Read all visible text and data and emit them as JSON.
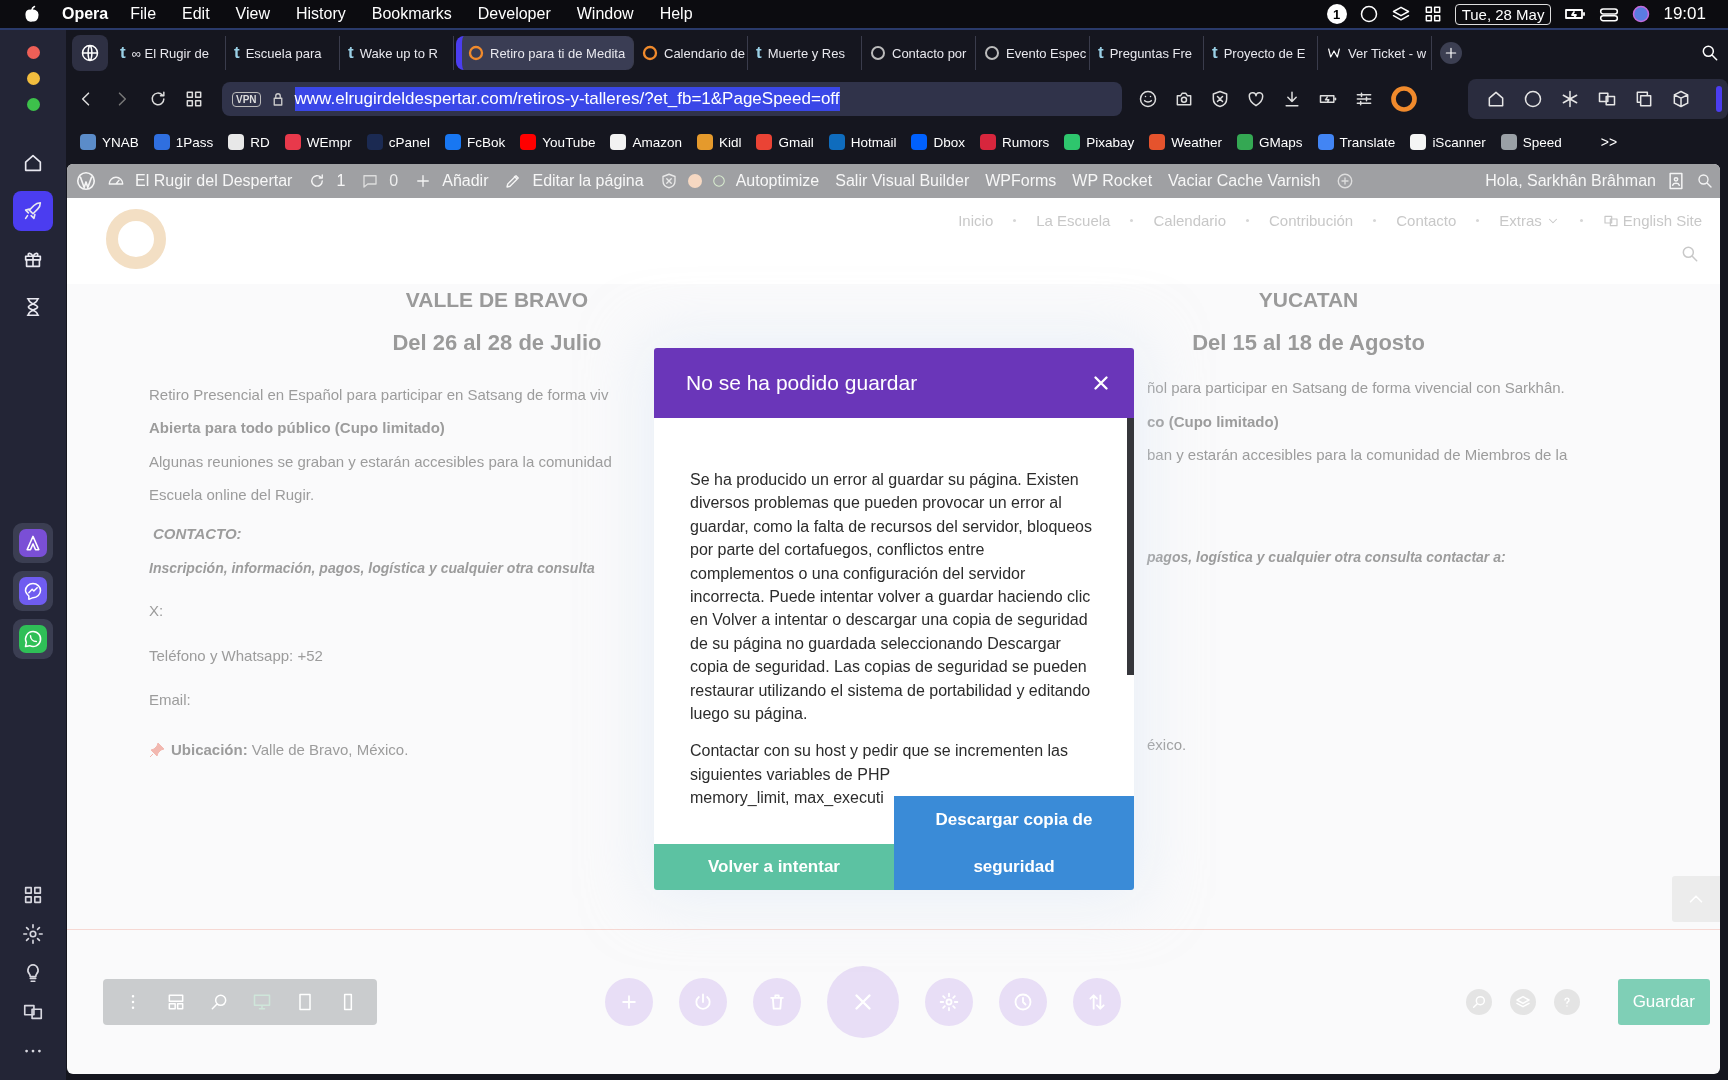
{
  "menubar": {
    "app": "Opera",
    "menus": [
      "File",
      "Edit",
      "View",
      "History",
      "Bookmarks",
      "Developer",
      "Window",
      "Help"
    ],
    "badge": "1",
    "date": "Tue, 28 May",
    "time": "19:01"
  },
  "sidebar": {
    "top": [
      {
        "kind": "home",
        "selected": false
      },
      {
        "kind": "rocket",
        "selected": true
      },
      {
        "kind": "gift",
        "selected": false
      },
      {
        "kind": "hourglass",
        "selected": false
      }
    ],
    "apps": [
      {
        "kind": "aria",
        "color": "#7a4fd6"
      },
      {
        "kind": "messenger",
        "color": "#6f5cf0"
      },
      {
        "kind": "whatsapp",
        "color": "#2fbf57"
      }
    ],
    "bottom": [
      {
        "kind": "grid"
      },
      {
        "kind": "settings"
      },
      {
        "kind": "bulb"
      },
      {
        "kind": "translate"
      },
      {
        "kind": "more"
      }
    ]
  },
  "tabs": [
    {
      "kind": "letter",
      "glyph": "t",
      "title": "∞ El Rugir de",
      "selected": false
    },
    {
      "kind": "letter",
      "glyph": "t",
      "title": "Escuela para",
      "selected": false
    },
    {
      "kind": "letter",
      "glyph": "t",
      "title": "Wake up to R",
      "selected": false
    },
    {
      "kind": "ring",
      "title": "Retiro para ti de Medita",
      "selected": true
    },
    {
      "kind": "ring",
      "title": "Calendario de",
      "selected": false
    },
    {
      "kind": "letter",
      "glyph": "t",
      "title": "Muerte y Res",
      "selected": false
    },
    {
      "kind": "chat",
      "title": "Contacto por",
      "selected": false
    },
    {
      "kind": "chat",
      "title": "Evento Espec",
      "selected": false
    },
    {
      "kind": "letter",
      "glyph": "t",
      "title": "Preguntas Fre",
      "selected": false
    },
    {
      "kind": "letter",
      "glyph": "t",
      "title": "Proyecto de E",
      "selected": false
    },
    {
      "kind": "w",
      "title": "Ver Ticket - w",
      "selected": false
    }
  ],
  "address": {
    "vpn": "VPN",
    "url": "www.elrugirdeldespertar.com/retiros-y-talleres/?et_fb=1&PageSpeed=off",
    "highlighted": true
  },
  "bookmarks": [
    {
      "label": "YNAB",
      "color": "#5b8cc9"
    },
    {
      "label": "1Pass",
      "color": "#2f6fe0"
    },
    {
      "label": "RD",
      "color": "#e8e8e8"
    },
    {
      "label": "WEmpr",
      "color": "#e8394b"
    },
    {
      "label": "cPanel",
      "color": "#1b2a52"
    },
    {
      "label": "FcBok",
      "color": "#1877f2"
    },
    {
      "label": "YouTube",
      "color": "#ff0000"
    },
    {
      "label": "Amazon",
      "color": "#f2f2f2"
    },
    {
      "label": "Kidl",
      "color": "#e59a2c"
    },
    {
      "label": "Gmail",
      "color": "#ea4335"
    },
    {
      "label": "Hotmail",
      "color": "#0f6cbd"
    },
    {
      "label": "Dbox",
      "color": "#0061fe"
    },
    {
      "label": "Rumors",
      "color": "#d7263d"
    },
    {
      "label": "Pixabay",
      "color": "#2ec66d"
    },
    {
      "label": "Weather",
      "color": "#e5532d"
    },
    {
      "label": "GMaps",
      "color": "#34a853"
    },
    {
      "label": "Translate",
      "color": "#4285f4"
    },
    {
      "label": "iScanner",
      "color": "#f5f5f5"
    },
    {
      "label": "Speed",
      "color": "#9aa0a6"
    }
  ],
  "bookmarks_more": ">>",
  "admin_bar": {
    "site": "El Rugir del Despertar",
    "updates": "1",
    "comments": "0",
    "items": [
      "Añadir",
      "Editar la página"
    ],
    "plugins": [
      "Autoptimize",
      "Salir Visual Builder",
      "WPForms",
      "WP Rocket",
      "Vaciar Cache Varnish"
    ],
    "greeting": "Hola, Sarkhân Brâhman"
  },
  "site_nav": {
    "items": [
      {
        "label": "Inicio",
        "dropdown": false
      },
      {
        "label": "La Escuela",
        "dropdown": false
      },
      {
        "label": "Calendario",
        "dropdown": false
      },
      {
        "label": "Contribución",
        "dropdown": false
      },
      {
        "label": "Contacto",
        "dropdown": false
      },
      {
        "label": "Extras",
        "dropdown": true
      }
    ],
    "language": "English Site"
  },
  "events": {
    "headings": [
      {
        "place": "VALLE DE BRAVO",
        "dates": "Del 26 al 28 de Julio"
      },
      {
        "place": "YUCATAN",
        "dates": "Del 15 al 18 de Agosto"
      }
    ],
    "rows": [
      {
        "kind": "text",
        "left": "Retiro Presencial en Español para participar en Satsang de forma viv",
        "right": "ñol para participar en Satsang de forma vivencial con Sarkhân."
      },
      {
        "kind": "bold",
        "left": "Abierta para todo público (Cupo limitado)",
        "right": "co (Cupo limitado)"
      },
      {
        "kind": "text",
        "left": "Algunas reuniones se graban y estarán accesibles para la comunidad",
        "right": "ban y estarán accesibles para la comunidad de Miembros de la"
      },
      {
        "kind": "text",
        "left": "Escuela online del Rugir."
      },
      {
        "kind": "label",
        "left": "CONTACTO:"
      },
      {
        "kind": "emphasis",
        "left": "Inscripción, información, pagos, logística y cualquier otra consulta",
        "right": "pagos, logística y cualquier otra consulta contactar a:"
      },
      {
        "kind": "field",
        "left": "X:"
      },
      {
        "kind": "field",
        "left": "Teléfono y Whatsapp: +52"
      },
      {
        "kind": "field",
        "left": "Email:"
      },
      {
        "kind": "location",
        "left": "**Ubicación:** Valle de Bravo, México.",
        "right": "éxico."
      }
    ]
  },
  "dialog": {
    "title": "No se ha podido guardar",
    "paragraphs": [
      "Se ha producido un error al guardar su página. Existen diversos problemas que pueden provocar un error al guardar, como la falta de recursos del servidor, bloqueos por parte del cortafuegos, conflictos entre complementos o una configuración del servidor incorrecta. Puede intentar volver a guardar haciendo clic en Volver a intentar o descargar una copia de seguridad de su página no guardada seleccionando Descargar copia de seguridad. Las copias de seguridad se pueden restaurar utilizando el sistema de portabilidad y editando luego su página.",
      "Contactar con su host y pedir que se incrementen las siguientes variables de PHP\nmemory_limit, max_executi"
    ],
    "retry": "Volver a intentar",
    "download": "Descargar copia de seguridad"
  },
  "builder_bar": {
    "views": [
      {
        "kind": "dots-v",
        "selected": false
      },
      {
        "kind": "layout",
        "selected": false
      },
      {
        "kind": "zoom",
        "selected": false
      },
      {
        "kind": "desktop",
        "selected": true
      },
      {
        "kind": "tablet",
        "selected": false
      },
      {
        "kind": "phone",
        "selected": false
      }
    ],
    "actions": [
      {
        "kind": "plus"
      },
      {
        "kind": "power"
      },
      {
        "kind": "trash"
      },
      {
        "kind": "close"
      },
      {
        "kind": "settings"
      },
      {
        "kind": "clock"
      },
      {
        "kind": "sort"
      }
    ],
    "tools": [
      {
        "kind": "zoom"
      },
      {
        "kind": "layers"
      },
      {
        "kind": "help"
      }
    ],
    "save": "Guardar"
  }
}
